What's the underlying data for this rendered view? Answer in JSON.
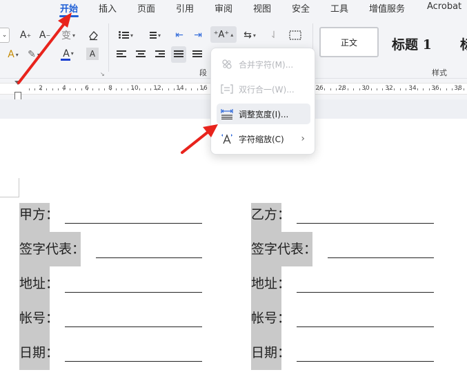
{
  "menu": {
    "tabs": [
      "开始",
      "插入",
      "页面",
      "引用",
      "审阅",
      "视图",
      "安全",
      "工具",
      "增值服务",
      "Acrobat"
    ]
  },
  "ribbon": {
    "font_grow": "A",
    "font_shrink": "A",
    "phonetic": "变",
    "text_effect": "A",
    "font_color": "A",
    "char_shading": "A",
    "para_label": "段",
    "style_label": "样式",
    "styles": {
      "normal": "正文",
      "h1": "标题 1",
      "h2": "标"
    }
  },
  "ruler": {
    "numbers": [
      "2",
      "4",
      "6",
      "8",
      "10",
      "12",
      "14",
      "16",
      "26",
      "28",
      "30",
      "32",
      "34",
      "36",
      "38"
    ]
  },
  "dropdown": {
    "items": [
      {
        "label": "合并字符(M)...",
        "icon": "merge-chars-icon"
      },
      {
        "label": "双行合一(W)...",
        "icon": "two-lines-icon"
      },
      {
        "label": "调整宽度(I)...",
        "icon": "adjust-width-icon"
      },
      {
        "label": "字符缩放(C)",
        "icon": "char-scale-icon"
      }
    ]
  },
  "document": {
    "left": [
      "甲方：",
      "签字代表：",
      "地址：",
      "帐号：",
      "日期："
    ],
    "right": [
      "乙方：",
      "签字代表：",
      "地址：",
      "帐号：",
      "日期："
    ]
  },
  "colors": {
    "accent": "#1f5fd6",
    "arrow": "#e8231c",
    "highlight": "#c9c9c9",
    "chrome": "#f3f4f7"
  }
}
